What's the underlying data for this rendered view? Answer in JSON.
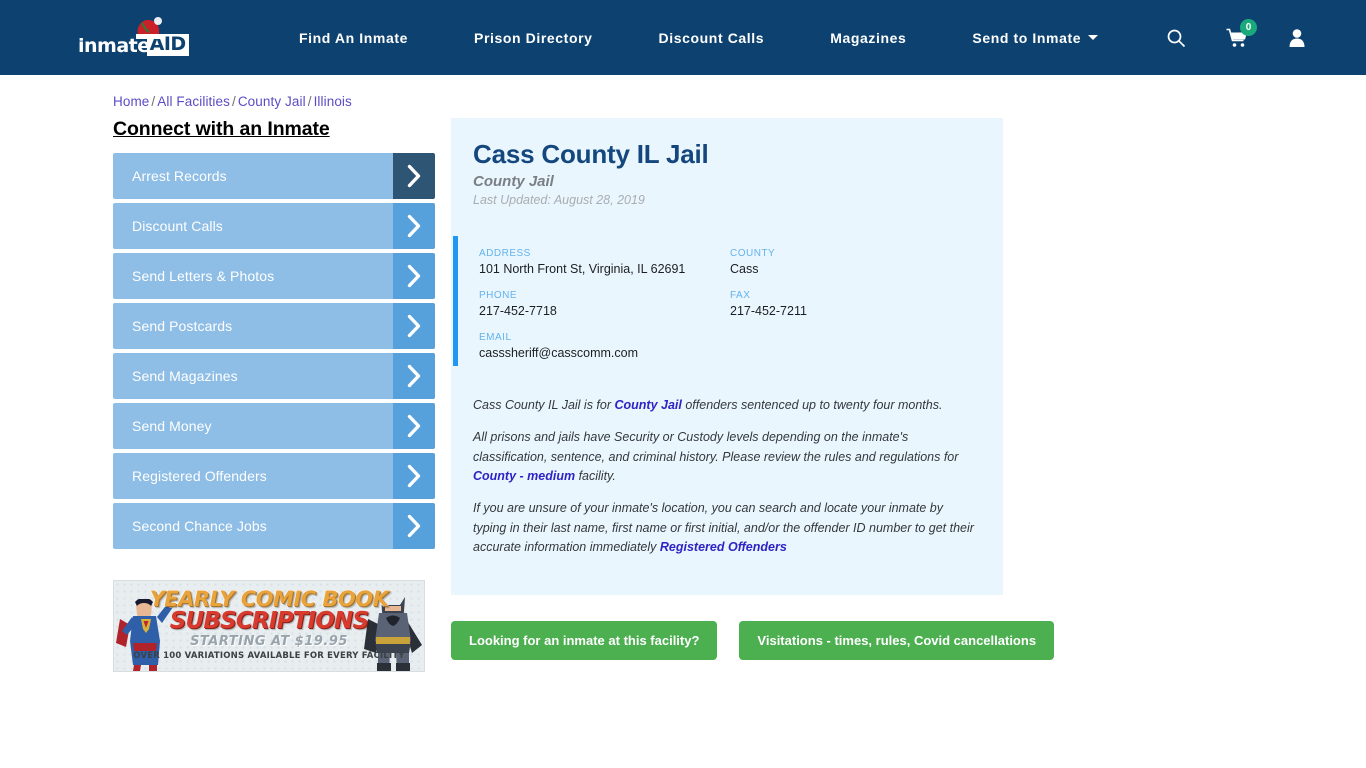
{
  "header": {
    "logo": {
      "text_primary": "inmate",
      "text_boxed": "AID",
      "icon": "santa-hat-icon"
    },
    "nav": [
      {
        "label": "Find An Inmate"
      },
      {
        "label": "Prison Directory"
      },
      {
        "label": "Discount Calls"
      },
      {
        "label": "Magazines"
      },
      {
        "label": "Send to Inmate",
        "has_dropdown": true
      }
    ],
    "search_icon": "search-icon",
    "cart_icon": "shopping-cart-icon",
    "cart_count": "0",
    "account_icon": "user-account-icon",
    "background_color": "#0d4270",
    "cart_badge_color": "#1aa97b"
  },
  "breadcrumb": {
    "items": [
      "Home",
      "All Facilities",
      "County Jail",
      "Illinois"
    ],
    "separator": "/",
    "link_color": "#5b4cc4"
  },
  "sidebar": {
    "title": "Connect with an Inmate",
    "items": [
      {
        "label": "Arrest Records",
        "active": true
      },
      {
        "label": "Discount Calls",
        "active": false
      },
      {
        "label": "Send Letters & Photos",
        "active": false
      },
      {
        "label": "Send Postcards",
        "active": false
      },
      {
        "label": "Send Magazines",
        "active": false
      },
      {
        "label": "Send Money",
        "active": false
      },
      {
        "label": "Registered Offenders",
        "active": false
      },
      {
        "label": "Second Chance Jobs",
        "active": false
      }
    ],
    "item_color": "#8ebde5",
    "arrow_color": "#56a0dc",
    "arrow_active_color": "#2f5575"
  },
  "ad": {
    "line1": "YEARLY COMIC BOOK",
    "line2": "SUBSCRIPTIONS",
    "line3": "STARTING AT $19.95",
    "line4": "OVER 100 VARIATIONS AVAILABLE FOR EVERY FACILITY",
    "left_figure": "superman-figure",
    "right_figure": "batman-figure"
  },
  "facility": {
    "title": "Cass County IL Jail",
    "subtitle": "County Jail",
    "last_updated": "Last Updated: August 28, 2019",
    "accent_color": "#2196f3",
    "card_background": "#eaf6fd",
    "info": [
      {
        "label": "ADDRESS",
        "value": "101 North Front St, Virginia, IL 62691",
        "span": "half"
      },
      {
        "label": "COUNTY",
        "value": "Cass",
        "span": "half"
      },
      {
        "label": "PHONE",
        "value": "217-452-7718",
        "span": "half"
      },
      {
        "label": "FAX",
        "value": "217-452-7211",
        "span": "half"
      },
      {
        "label": "EMAIL",
        "value": "casssheriff@casscomm.com",
        "span": "full"
      }
    ],
    "paragraphs": {
      "p1_a": "Cass County IL Jail is for ",
      "p1_link": "County Jail",
      "p1_b": " offenders sentenced up to twenty four months.",
      "p2_a": "All prisons and jails have Security or Custody levels depending on the inmate's classification, sentence, and criminal history. Please review the rules and regulations for ",
      "p2_link": "County - medium",
      "p2_b": " facility.",
      "p3_a": "If you are unsure of your inmate's location, you can search and locate your inmate by typing in their last name, first name or first initial, and/or the offender ID number to get their accurate information immediately ",
      "p3_link": "Registered Offenders"
    },
    "buttons": [
      {
        "label": "Looking for an inmate at this facility?"
      },
      {
        "label": "Visitations - times, rules, Covid cancellations"
      }
    ],
    "button_color": "#4caf50"
  }
}
